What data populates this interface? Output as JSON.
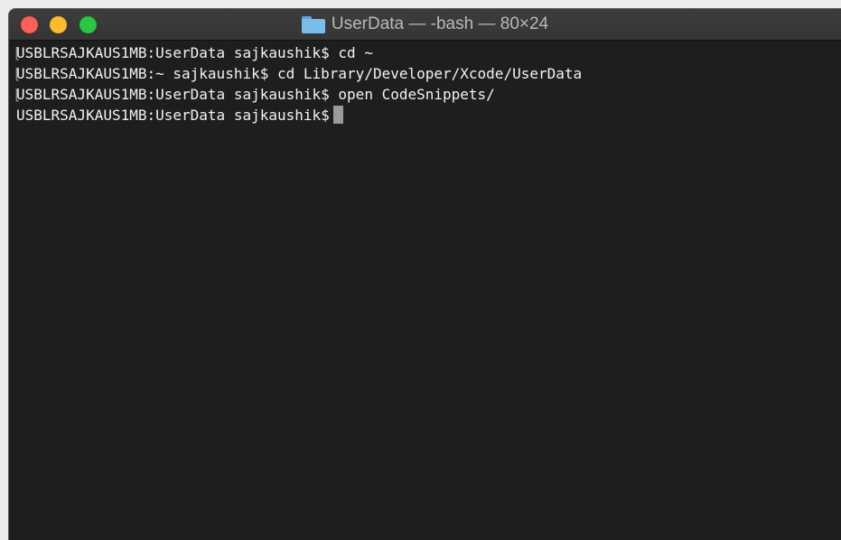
{
  "window": {
    "title": "UserData — -bash — 80×24"
  },
  "terminal": {
    "lines": [
      {
        "marker": "[",
        "text": "USBLRSAJKAUS1MB:UserData sajkaushik$ cd ~"
      },
      {
        "marker": "[",
        "text": "USBLRSAJKAUS1MB:~ sajkaushik$ cd Library/Developer/Xcode/UserData"
      },
      {
        "marker": "[",
        "text": "USBLRSAJKAUS1MB:UserData sajkaushik$ open CodeSnippets/"
      },
      {
        "marker": "",
        "text": "USBLRSAJKAUS1MB:UserData sajkaushik$"
      }
    ]
  },
  "colors": {
    "background": "#1e1e1e",
    "text": "#f2f2f2",
    "close": "#fe5f57",
    "minimize": "#febb2e",
    "zoom": "#28c840"
  }
}
